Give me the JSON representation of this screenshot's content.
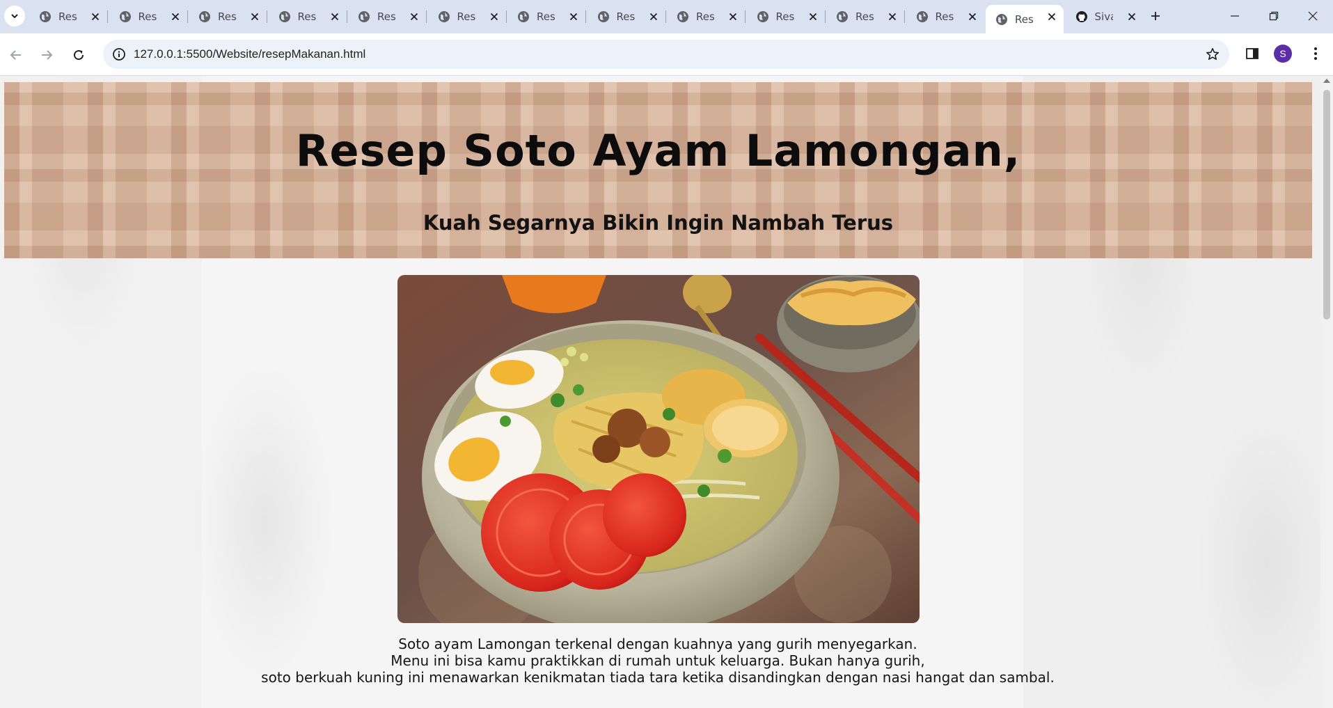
{
  "browser": {
    "tabs": [
      {
        "title": "Resep Makanan",
        "active": false
      },
      {
        "title": "Resep Makanan",
        "active": false
      },
      {
        "title": "Resep Makanan",
        "active": false
      },
      {
        "title": "Resep Makanan",
        "active": false
      },
      {
        "title": "Resep Makanan",
        "active": false
      },
      {
        "title": "Resep Makanan",
        "active": false
      },
      {
        "title": "Resep Makanan",
        "active": false
      },
      {
        "title": "Resep Makanan",
        "active": false
      },
      {
        "title": "Resep Makanan",
        "active": false
      },
      {
        "title": "Resep Makanan",
        "active": false
      },
      {
        "title": "Resep Makanan",
        "active": false
      },
      {
        "title": "Resep Makanan",
        "active": false
      },
      {
        "title": "Resep Makanan",
        "active": true
      },
      {
        "title": "Sivanza",
        "active": false,
        "icon": "github-icon"
      }
    ],
    "url": "127.0.0.1:5500/Website/resepMakanan.html",
    "profile_initial": "S",
    "colors": {
      "tabstrip": "#dae2f2",
      "avatar": "#5a2ea6"
    }
  },
  "page": {
    "title": "Resep Soto Ayam Lamongan,",
    "subtitle": "Kuah Segarnya Bikin Ingin Nambah Terus",
    "image_alt": "Soto Ayam Lamongan",
    "description": [
      "Soto ayam Lamongan terkenal dengan kuahnya yang gurih menyegarkan.",
      "Menu ini bisa kamu praktikkan di rumah untuk keluarga. Bukan hanya gurih,",
      "soto berkuah kuning ini menawarkan kenikmatan tiada tara ketika disandingkan dengan nasi hangat dan sambal."
    ],
    "colors": {
      "banner": "#d6b49c"
    }
  }
}
